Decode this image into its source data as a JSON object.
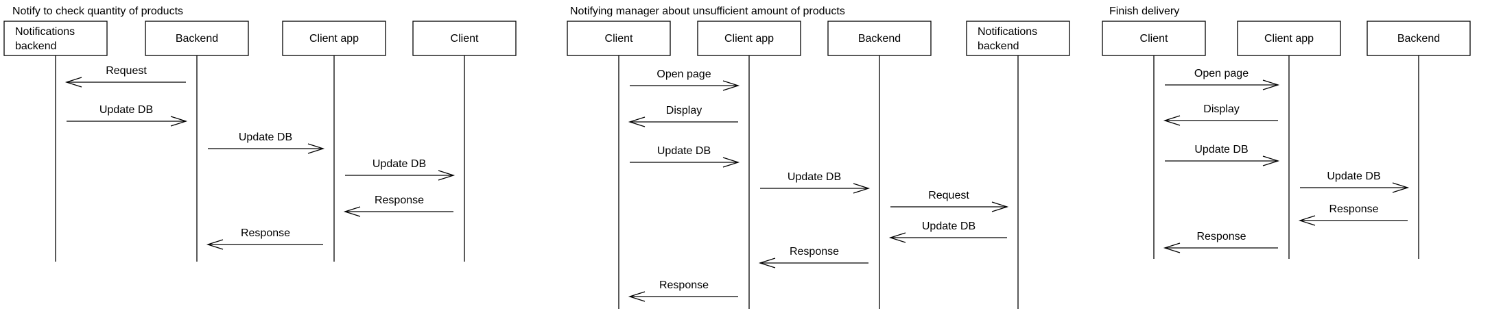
{
  "diagrams": [
    {
      "title": "Notify to check quantity of products",
      "actors": [
        "Notifications backend",
        "Backend",
        "Client app",
        "Client"
      ],
      "messages": [
        {
          "from": 1,
          "to": 0,
          "label": "Request"
        },
        {
          "from": 0,
          "to": 1,
          "label": "Update DB"
        },
        {
          "from": 1,
          "to": 2,
          "label": "Update DB"
        },
        {
          "from": 2,
          "to": 3,
          "label": "Update DB"
        },
        {
          "from": 3,
          "to": 2,
          "label": "Response"
        },
        {
          "from": 2,
          "to": 1,
          "label": "Response"
        }
      ]
    },
    {
      "title": "Notifying manager about unsufficient amount of products",
      "actors": [
        "Client",
        "Client app",
        "Backend",
        "Notifications backend"
      ],
      "messages": [
        {
          "from": 0,
          "to": 1,
          "label": "Open page"
        },
        {
          "from": 1,
          "to": 0,
          "label": "Display"
        },
        {
          "from": 0,
          "to": 1,
          "label": "Update DB"
        },
        {
          "from": 1,
          "to": 2,
          "label": "Update DB"
        },
        {
          "from": 2,
          "to": 3,
          "label": "Request"
        },
        {
          "from": 3,
          "to": 2,
          "label": "Update DB"
        },
        {
          "from": 2,
          "to": 1,
          "label": "Response"
        },
        {
          "from": 1,
          "to": 0,
          "label": "Response"
        }
      ]
    },
    {
      "title": "Finish delivery",
      "actors": [
        "Client",
        "Client app",
        "Backend"
      ],
      "messages": [
        {
          "from": 0,
          "to": 1,
          "label": "Open page"
        },
        {
          "from": 1,
          "to": 0,
          "label": "Display"
        },
        {
          "from": 0,
          "to": 1,
          "label": "Update DB"
        },
        {
          "from": 1,
          "to": 2,
          "label": "Update DB"
        },
        {
          "from": 2,
          "to": 1,
          "label": "Response"
        },
        {
          "from": 1,
          "to": 0,
          "label": "Response"
        }
      ]
    }
  ],
  "colors": {
    "line": "#000000",
    "box_fill": "#ffffff",
    "background": "#ffffff"
  }
}
